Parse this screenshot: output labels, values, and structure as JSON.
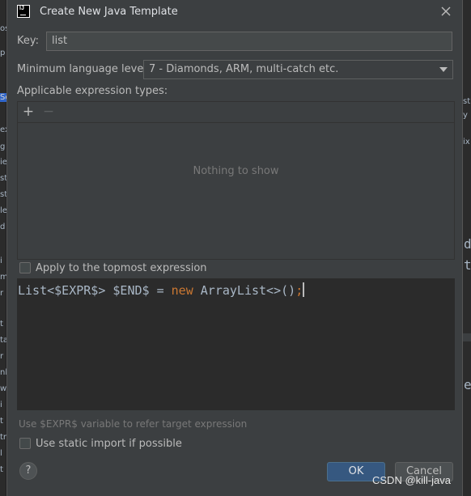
{
  "dialog": {
    "title": "Create New Java Template",
    "key": {
      "label": "Key:",
      "value": "list"
    },
    "language_level": {
      "label": "Minimum language level:",
      "selected": "7 - Diamonds, ARM, multi-catch etc."
    },
    "expression_types": {
      "label": "Applicable expression types:",
      "add_icon": "+",
      "remove_icon": "−",
      "empty_text": "Nothing to show"
    },
    "topmost_checkbox": {
      "label": "Apply to the topmost expression",
      "checked": false
    },
    "template_code": {
      "type_part": "List<$EXPR$> $END$ = ",
      "keyword": "new",
      "rest": " ArrayList<>()",
      "semicolon": ";"
    },
    "hint": "Use $EXPR$ variable to refer target expression",
    "static_import_checkbox": {
      "label": "Use static import if possible",
      "checked": false
    },
    "buttons": {
      "help": "?",
      "ok": "OK",
      "cancel": "Cancel"
    }
  },
  "watermark": "CSDN @kill-java",
  "background": {
    "left_fragments": [
      "os",
      "p",
      "Sc",
      "ex",
      "g",
      "ie",
      "st",
      "st",
      "le",
      "d",
      "i",
      "m",
      "r",
      "t",
      "ta",
      "r",
      "nl",
      "w",
      "i",
      "t",
      "tr",
      "l",
      "t"
    ],
    "right_fragments": [
      "st",
      "y",
      "ix"
    ],
    "right_code": [
      "d",
      "t",
      "e"
    ]
  },
  "colors": {
    "accent": "#365880",
    "keyword": "#cc7832",
    "background": "#3c3f41",
    "editor": "#2b2b2b"
  }
}
